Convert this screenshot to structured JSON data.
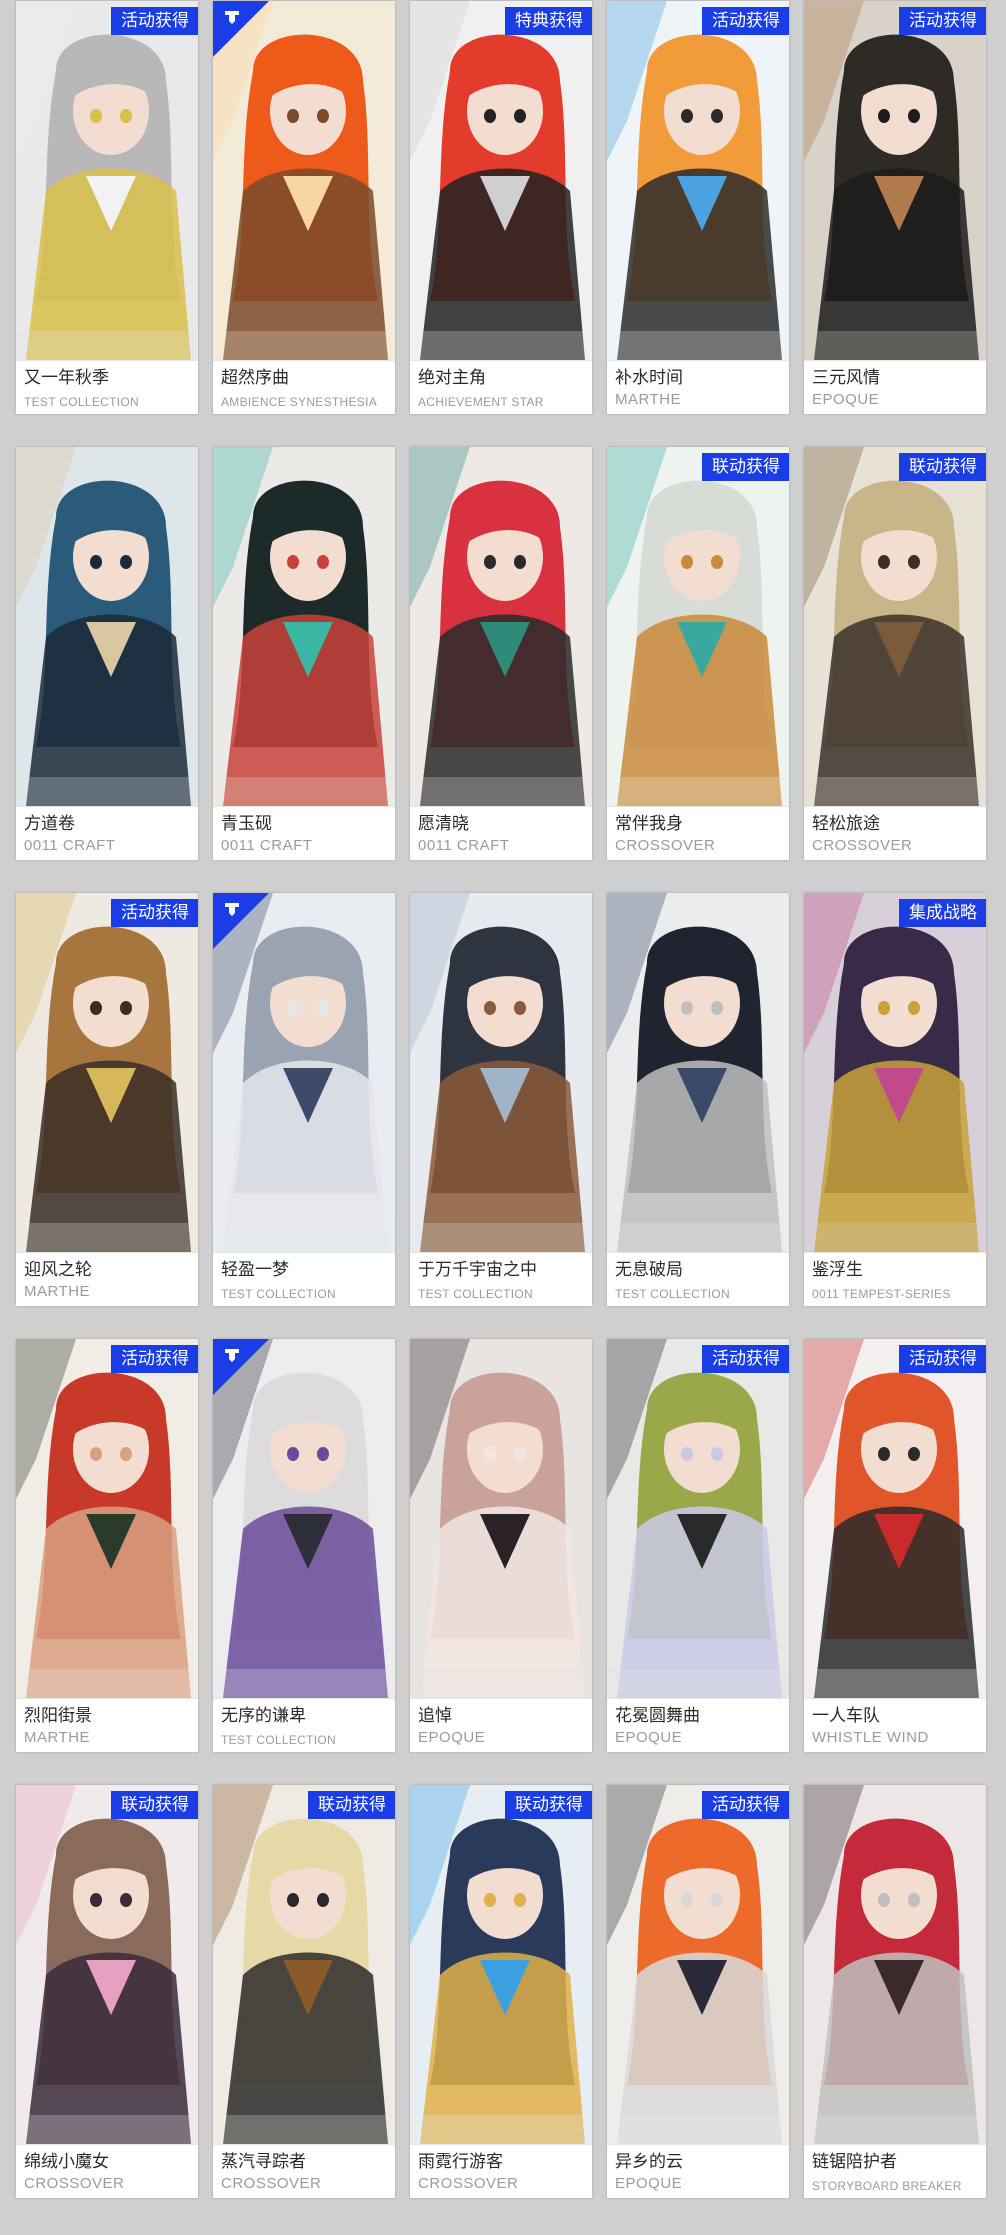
{
  "cards": [
    {
      "title": "又一年秋季",
      "subtitle": "TEST COLLECTION",
      "badge": "活动获得",
      "corner": false,
      "palette": [
        "#e9e9e9",
        "#b8b8b8",
        "#f2f2f2",
        "#d8c04a"
      ]
    },
    {
      "title": "超然序曲",
      "subtitle": "AMBIENCE SYNESTHESIA",
      "badge": "",
      "corner": true,
      "palette": [
        "#f4ead8",
        "#ee5a1a",
        "#f7d6a0",
        "#7a4a2a"
      ]
    },
    {
      "title": "绝对主角",
      "subtitle": "ACHIEVEMENT STAR",
      "badge": "特典获得",
      "corner": false,
      "palette": [
        "#f0f0f0",
        "#e33c2d",
        "#cfcfcf",
        "#222222"
      ]
    },
    {
      "title": "补水时间",
      "subtitle": "MARTHE",
      "badge": "活动获得",
      "corner": false,
      "palette": [
        "#eef4f8",
        "#f29b3a",
        "#4aa3e0",
        "#2b2b2b"
      ]
    },
    {
      "title": "三元风情",
      "subtitle": "EPOQUE",
      "badge": "活动获得",
      "corner": false,
      "palette": [
        "#d9d2c8",
        "#2e2a26",
        "#b07a4a",
        "#1c1c1c"
      ]
    },
    {
      "title": "方道卷",
      "subtitle": "0011 CRAFT",
      "badge": "",
      "corner": false,
      "palette": [
        "#dfe6ea",
        "#2a5b7a",
        "#d9c7a0",
        "#1b2a3a"
      ]
    },
    {
      "title": "青玉砚",
      "subtitle": "0011 CRAFT",
      "badge": "",
      "corner": false,
      "palette": [
        "#eceae6",
        "#1c2a2a",
        "#3bb6a3",
        "#c9423a"
      ]
    },
    {
      "title": "愿清晓",
      "subtitle": "0011 CRAFT",
      "badge": "",
      "corner": false,
      "palette": [
        "#efe9e6",
        "#d8313f",
        "#2f8a7a",
        "#2a2a2a"
      ]
    },
    {
      "title": "常伴我身",
      "subtitle": "CROSSOVER",
      "badge": "联动获得",
      "corner": false,
      "palette": [
        "#eef3ef",
        "#d7dcd6",
        "#39a9a0",
        "#c98a3a"
      ]
    },
    {
      "title": "轻松旅途",
      "subtitle": "CROSSOVER",
      "badge": "联动获得",
      "corner": false,
      "palette": [
        "#e7e1d6",
        "#c9b58a",
        "#7a5a3a",
        "#3a3028"
      ]
    },
    {
      "title": "迎风之轮",
      "subtitle": "MARTHE",
      "badge": "活动获得",
      "corner": false,
      "palette": [
        "#eeeae2",
        "#a7763f",
        "#d6b85a",
        "#3a2e24"
      ]
    },
    {
      "title": "轻盈一梦",
      "subtitle": "TEST COLLECTION",
      "badge": "",
      "corner": true,
      "palette": [
        "#e9ecf0",
        "#9aa3b2",
        "#3d4a6a",
        "#e4e6ea"
      ]
    },
    {
      "title": "于万千宇宙之中",
      "subtitle": "TEST COLLECTION",
      "badge": "",
      "corner": false,
      "palette": [
        "#e7eaee",
        "#2e3440",
        "#a0b4c8",
        "#8a5a3a"
      ]
    },
    {
      "title": "无息破局",
      "subtitle": "TEST COLLECTION",
      "badge": "",
      "corner": false,
      "palette": [
        "#ececec",
        "#1f2430",
        "#3a4a6a",
        "#bfbfbf"
      ]
    },
    {
      "title": "鉴浮生",
      "subtitle": "0011 TEMPEST-SERIES",
      "badge": "集成战略",
      "corner": false,
      "palette": [
        "#d8d0d8",
        "#3a2a4a",
        "#c04a8a",
        "#c9a23a"
      ]
    },
    {
      "title": "烈阳街景",
      "subtitle": "MARTHE",
      "badge": "活动获得",
      "corner": false,
      "palette": [
        "#f1ece6",
        "#c73a2a",
        "#2a3a2a",
        "#d8a080"
      ]
    },
    {
      "title": "无序的谦卑",
      "subtitle": "TEST COLLECTION",
      "badge": "",
      "corner": true,
      "palette": [
        "#ecedef",
        "#dcdcdc",
        "#2c2f3a",
        "#6a4a9a"
      ]
    },
    {
      "title": "追悼",
      "subtitle": "EPOQUE",
      "badge": "",
      "corner": false,
      "palette": [
        "#e8e4e2",
        "#c9a29a",
        "#2a2226",
        "#f2e6e2"
      ]
    },
    {
      "title": "花冕圆舞曲",
      "subtitle": "EPOQUE",
      "badge": "活动获得",
      "corner": false,
      "palette": [
        "#e6e9e6",
        "#9aa84a",
        "#2a2a2a",
        "#c9c9e6"
      ]
    },
    {
      "title": "一人车队",
      "subtitle": "WHISTLE WIND",
      "badge": "活动获得",
      "corner": false,
      "palette": [
        "#f2efee",
        "#e0562a",
        "#c92a2a",
        "#2a2a2a"
      ]
    },
    {
      "title": "绵绒小魔女",
      "subtitle": "CROSSOVER",
      "badge": "联动获得",
      "corner": false,
      "palette": [
        "#f1eaea",
        "#8a6a5a",
        "#e6a0c0",
        "#3a2a3a"
      ]
    },
    {
      "title": "蒸汽寻踪者",
      "subtitle": "CROSSOVER",
      "badge": "联动获得",
      "corner": false,
      "palette": [
        "#efeae2",
        "#e6d9a6",
        "#8a5a2a",
        "#2a2a2a"
      ]
    },
    {
      "title": "雨霓行游客",
      "subtitle": "CROSSOVER",
      "badge": "联动获得",
      "corner": false,
      "palette": [
        "#e6eef4",
        "#2a3a5a",
        "#3aa0e0",
        "#e0b04a"
      ]
    },
    {
      "title": "异乡的云",
      "subtitle": "EPOQUE",
      "badge": "活动获得",
      "corner": false,
      "palette": [
        "#efedea",
        "#ec6a2a",
        "#2a2a3a",
        "#d8d8d8"
      ]
    },
    {
      "title": "链锯陪护者",
      "subtitle": "STORYBOARD BREAKER",
      "badge": "",
      "corner": false,
      "palette": [
        "#ece6e6",
        "#c42a3a",
        "#3a2a2a",
        "#bfbfbf"
      ]
    }
  ]
}
